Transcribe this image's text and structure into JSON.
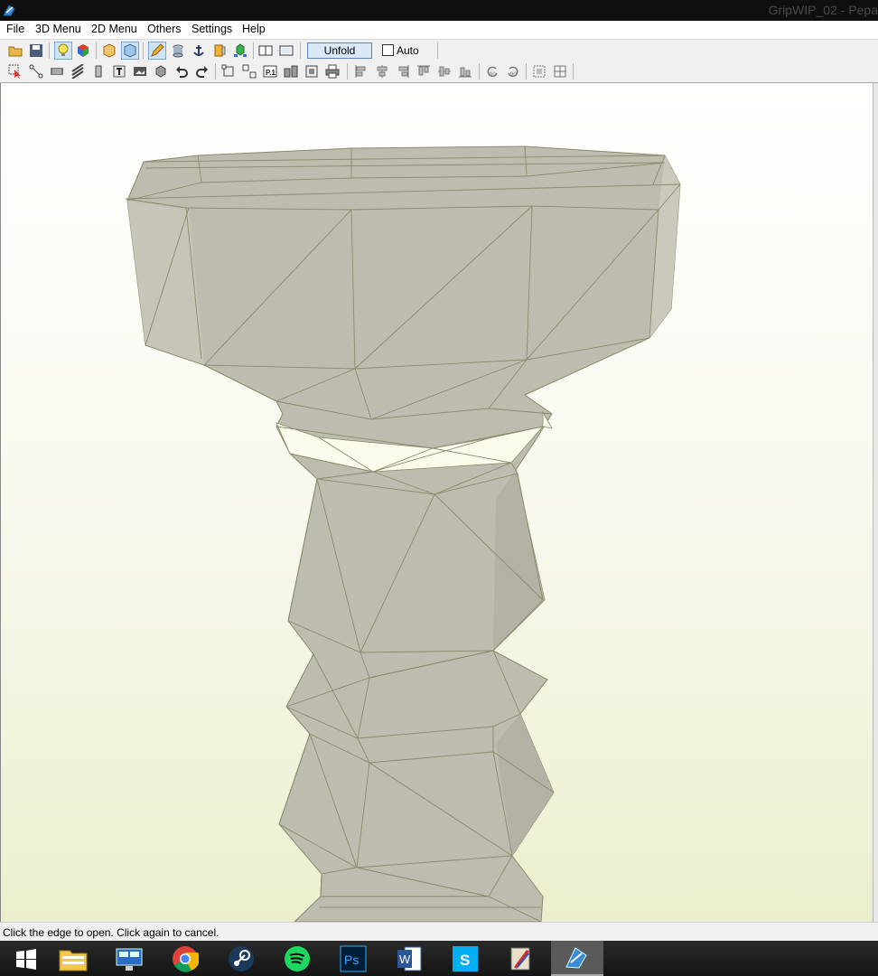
{
  "window": {
    "title": "GripWIP_02 - Pepa",
    "app_icon": "pepakura-icon"
  },
  "menu": [
    "File",
    "3D Menu",
    "2D Menu",
    "Others",
    "Settings",
    "Help"
  ],
  "toolbar": {
    "unfold_label": "Unfold",
    "auto_label": "Auto",
    "auto_checked": false
  },
  "status": {
    "text": "Click the edge to open. Click again to cancel."
  },
  "taskbar": {
    "items": [
      "windows-start-icon",
      "file-explorer-icon",
      "network-icon",
      "chrome-icon",
      "steam-icon",
      "spotify-icon",
      "photoshop-icon",
      "word-icon",
      "skype-icon",
      "paint-tool-icon",
      "pepakura-icon"
    ]
  },
  "colors": {
    "model_face": "#bdbcae",
    "model_edge": "#8a8a6c",
    "model_open_face": "#fbfbec",
    "viewport_bottom": "#ecefcd"
  }
}
